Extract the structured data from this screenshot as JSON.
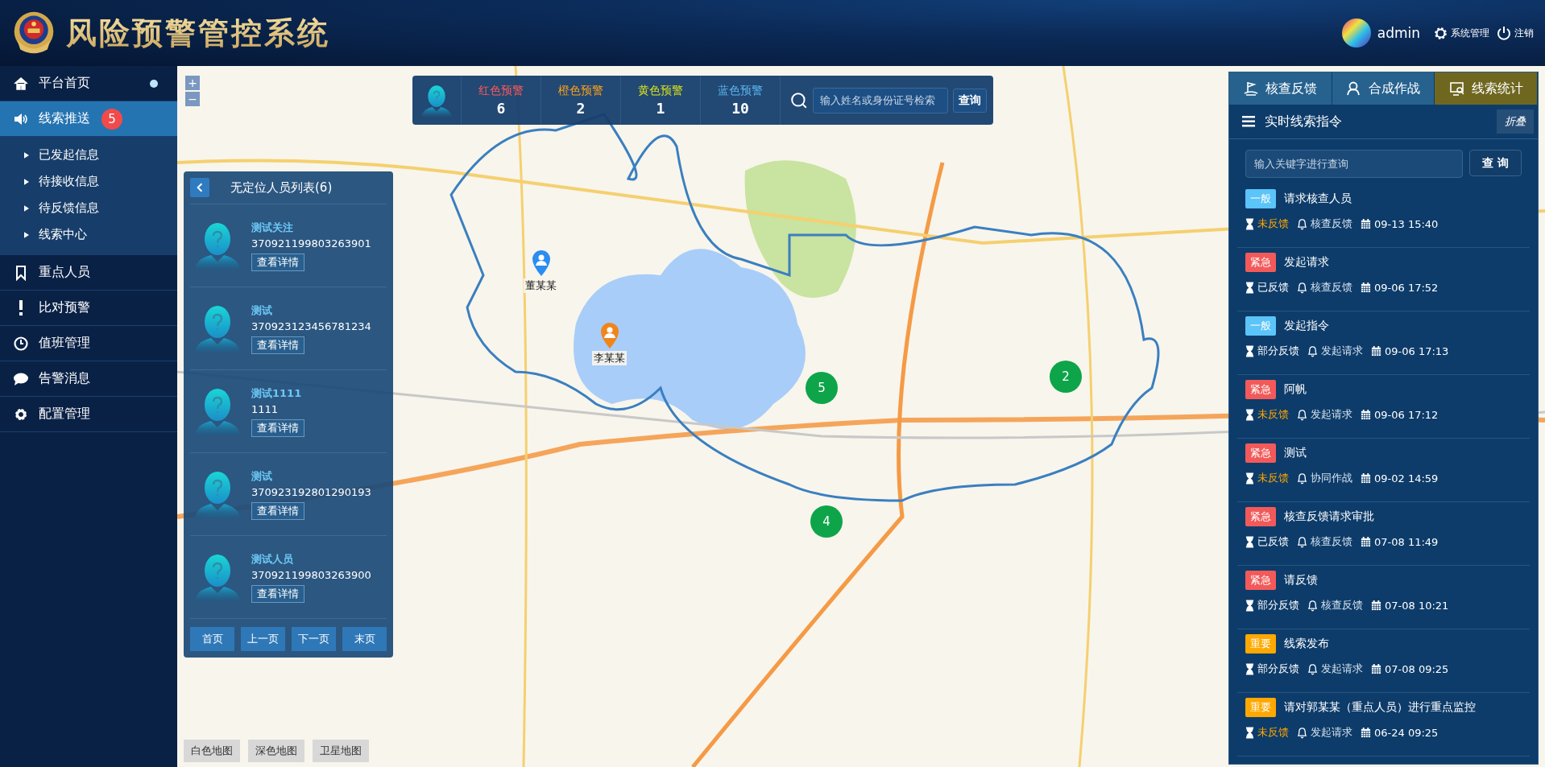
{
  "header": {
    "title": "风险预警管控系统",
    "user": "admin",
    "links": [
      {
        "label": "系统管理",
        "kind": "settings"
      },
      {
        "label": "注销",
        "kind": "logout"
      }
    ]
  },
  "sidebar": {
    "items": [
      {
        "label": "平台首页",
        "selected": false,
        "dot": true
      },
      {
        "label": "线索推送",
        "selected": true,
        "badge": "5",
        "dot": false,
        "expanded": true,
        "children": [
          {
            "label": "已发起信息"
          },
          {
            "label": "待接收信息"
          },
          {
            "label": "待反馈信息"
          },
          {
            "label": "线索中心"
          }
        ]
      },
      {
        "label": "重点人员",
        "selected": false,
        "dot": false
      },
      {
        "label": "比对预警",
        "selected": false,
        "dot": false
      },
      {
        "label": "值班管理",
        "selected": false,
        "dot": false
      },
      {
        "label": "告警消息",
        "selected": false,
        "dot": false
      },
      {
        "label": "配置管理",
        "selected": false,
        "dot": false
      }
    ]
  },
  "map": {
    "zoom_controls": [
      "+",
      "−"
    ],
    "markers": [
      {
        "name": "董某某",
        "color": "#2b8df0"
      },
      {
        "name": "李某某",
        "color": "#f0851c"
      }
    ],
    "clusters": [
      "5",
      "2",
      "4"
    ],
    "map_types": [
      "白色地图",
      "深色地图",
      "卫星地图"
    ]
  },
  "alert_bar": {
    "levels": [
      {
        "label": "红色预警",
        "count": "6",
        "color": "#ff5a5a"
      },
      {
        "label": "橙色预警",
        "count": "2",
        "color": "#ffa31a"
      },
      {
        "label": "黄色预警",
        "count": "1",
        "color": "#d8e21c"
      },
      {
        "label": "蓝色预警",
        "count": "10",
        "color": "#5db8f2"
      }
    ],
    "search": {
      "placeholder": "输入姓名或身份证号检索"
    },
    "button": "查询"
  },
  "person_list": {
    "title": "无定位人员列表(6)",
    "people": [
      {
        "name": "测试关注",
        "id_number": "370921199803263901",
        "button": "查看详情"
      },
      {
        "name": "测试",
        "id_number": "370923123456781234",
        "button": "查看详情"
      },
      {
        "name": "测试1111",
        "id_number": "1111",
        "button": "查看详情"
      },
      {
        "name": "测试",
        "id_number": "370923192801290193",
        "button": "查看详情"
      },
      {
        "name": "测试人员",
        "id_number": "370921199803263900",
        "button": "查看详情"
      }
    ],
    "pager": [
      "首页",
      "上一页",
      "下一页",
      "末页"
    ]
  },
  "clue_panel": {
    "tabs": [
      {
        "label": "核查反馈",
        "selected": false
      },
      {
        "label": "合成作战",
        "selected": false
      },
      {
        "label": "线索统计",
        "selected": true
      }
    ],
    "title": "实时线索指令",
    "collapse": "折叠",
    "search": {
      "placeholder": "输入关键字进行查询"
    },
    "button": "查 询",
    "items": [
      {
        "tag": {
          "label": "一般",
          "color": "#5bc4f8"
        },
        "title": "请求核查人员",
        "status": {
          "label": "未反馈",
          "pending": true
        },
        "type": "核查反馈",
        "time": "09-13 15:40"
      },
      {
        "tag": {
          "label": "紧急",
          "color": "#f25a5a"
        },
        "title": "发起请求",
        "status": {
          "label": "已反馈",
          "pending": false
        },
        "type": "核查反馈",
        "time": "09-06 17:52"
      },
      {
        "tag": {
          "label": "一般",
          "color": "#5bc4f8"
        },
        "title": "发起指令",
        "status": {
          "label": "部分反馈",
          "pending": false
        },
        "type": "发起请求",
        "time": "09-06 17:13"
      },
      {
        "tag": {
          "label": "紧急",
          "color": "#f25a5a"
        },
        "title": "阿帆",
        "status": {
          "label": "未反馈",
          "pending": true
        },
        "type": "发起请求",
        "time": "09-06 17:12"
      },
      {
        "tag": {
          "label": "紧急",
          "color": "#f25a5a"
        },
        "title": "测试",
        "status": {
          "label": "未反馈",
          "pending": true
        },
        "type": "协同作战",
        "time": "09-02 14:59"
      },
      {
        "tag": {
          "label": "紧急",
          "color": "#f25a5a"
        },
        "title": "核查反馈请求审批",
        "status": {
          "label": "已反馈",
          "pending": false
        },
        "type": "核查反馈",
        "time": "07-08 11:49"
      },
      {
        "tag": {
          "label": "紧急",
          "color": "#f25a5a"
        },
        "title": "请反馈",
        "status": {
          "label": "部分反馈",
          "pending": false
        },
        "type": "核查反馈",
        "time": "07-08 10:21"
      },
      {
        "tag": {
          "label": "重要",
          "color": "#ffa800"
        },
        "title": "线索发布",
        "status": {
          "label": "部分反馈",
          "pending": false
        },
        "type": "发起请求",
        "time": "07-08 09:25"
      },
      {
        "tag": {
          "label": "重要",
          "color": "#ffa800"
        },
        "title": "请对郭某某（重点人员）进行重点监控",
        "status": {
          "label": "未反馈",
          "pending": true
        },
        "type": "发起请求",
        "time": "06-24 09:25"
      }
    ]
  }
}
